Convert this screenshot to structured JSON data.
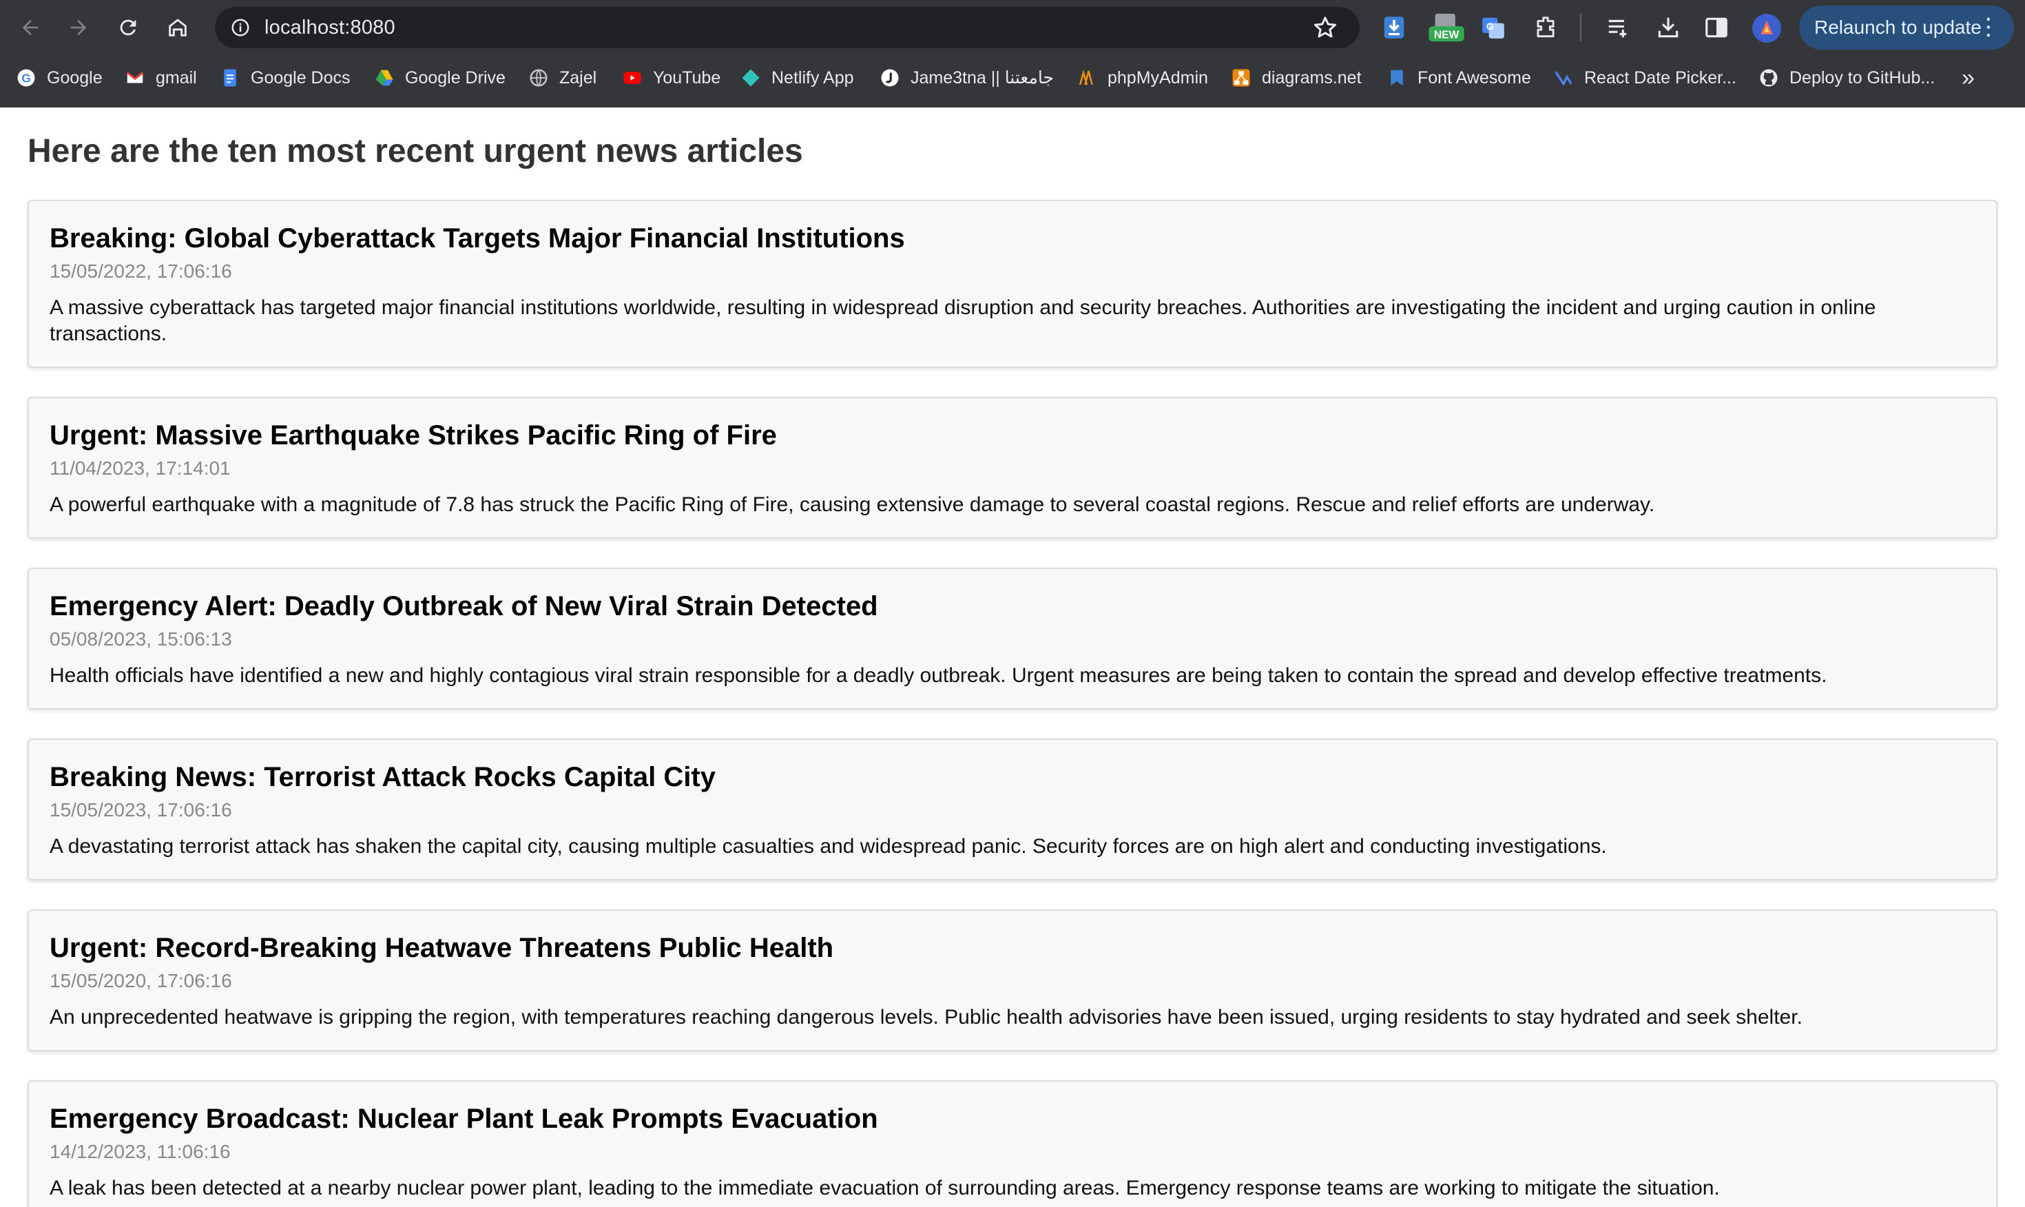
{
  "browser": {
    "url": "localhost:8080",
    "relaunch_label": "Relaunch to update",
    "bookmarks": [
      {
        "label": "Google",
        "icon": "google-icon"
      },
      {
        "label": "gmail",
        "icon": "gmail-icon"
      },
      {
        "label": "Google Docs",
        "icon": "docs-icon"
      },
      {
        "label": "Google Drive",
        "icon": "drive-icon"
      },
      {
        "label": "Zajel",
        "icon": "globe-icon"
      },
      {
        "label": "YouTube",
        "icon": "youtube-icon"
      },
      {
        "label": "Netlify App",
        "icon": "netlify-icon"
      },
      {
        "label": "Jame3tna || جامعتنا",
        "icon": "jame3tna-icon"
      },
      {
        "label": "phpMyAdmin",
        "icon": "phpmyadmin-icon"
      },
      {
        "label": "diagrams.net",
        "icon": "diagrams-icon"
      },
      {
        "label": "Font Awesome",
        "icon": "flag-icon"
      },
      {
        "label": "React Date Picker...",
        "icon": "react-datepicker-icon"
      },
      {
        "label": "Deploy to GitHub...",
        "icon": "github-icon"
      }
    ],
    "ext_new_badge": "NEW"
  },
  "page": {
    "title": "Here are the ten most recent urgent news articles",
    "articles": [
      {
        "title": "Breaking: Global Cyberattack Targets Major Financial Institutions",
        "date": "15/05/2022, 17:06:16",
        "body": "A massive cyberattack has targeted major financial institutions worldwide, resulting in widespread disruption and security breaches. Authorities are investigating the incident and urging caution in online transactions."
      },
      {
        "title": "Urgent: Massive Earthquake Strikes Pacific Ring of Fire",
        "date": "11/04/2023, 17:14:01",
        "body": "A powerful earthquake with a magnitude of 7.8 has struck the Pacific Ring of Fire, causing extensive damage to several coastal regions. Rescue and relief efforts are underway."
      },
      {
        "title": "Emergency Alert: Deadly Outbreak of New Viral Strain Detected",
        "date": "05/08/2023, 15:06:13",
        "body": "Health officials have identified a new and highly contagious viral strain responsible for a deadly outbreak. Urgent measures are being taken to contain the spread and develop effective treatments."
      },
      {
        "title": "Breaking News: Terrorist Attack Rocks Capital City",
        "date": "15/05/2023, 17:06:16",
        "body": "A devastating terrorist attack has shaken the capital city, causing multiple casualties and widespread panic. Security forces are on high alert and conducting investigations."
      },
      {
        "title": "Urgent: Record-Breaking Heatwave Threatens Public Health",
        "date": "15/05/2020, 17:06:16",
        "body": "An unprecedented heatwave is gripping the region, with temperatures reaching dangerous levels. Public health advisories have been issued, urging residents to stay hydrated and seek shelter."
      },
      {
        "title": "Emergency Broadcast: Nuclear Plant Leak Prompts Evacuation",
        "date": "14/12/2023, 11:06:16",
        "body": "A leak has been detected at a nearby nuclear power plant, leading to the immediate evacuation of surrounding areas. Emergency response teams are working to mitigate the situation."
      }
    ]
  }
}
